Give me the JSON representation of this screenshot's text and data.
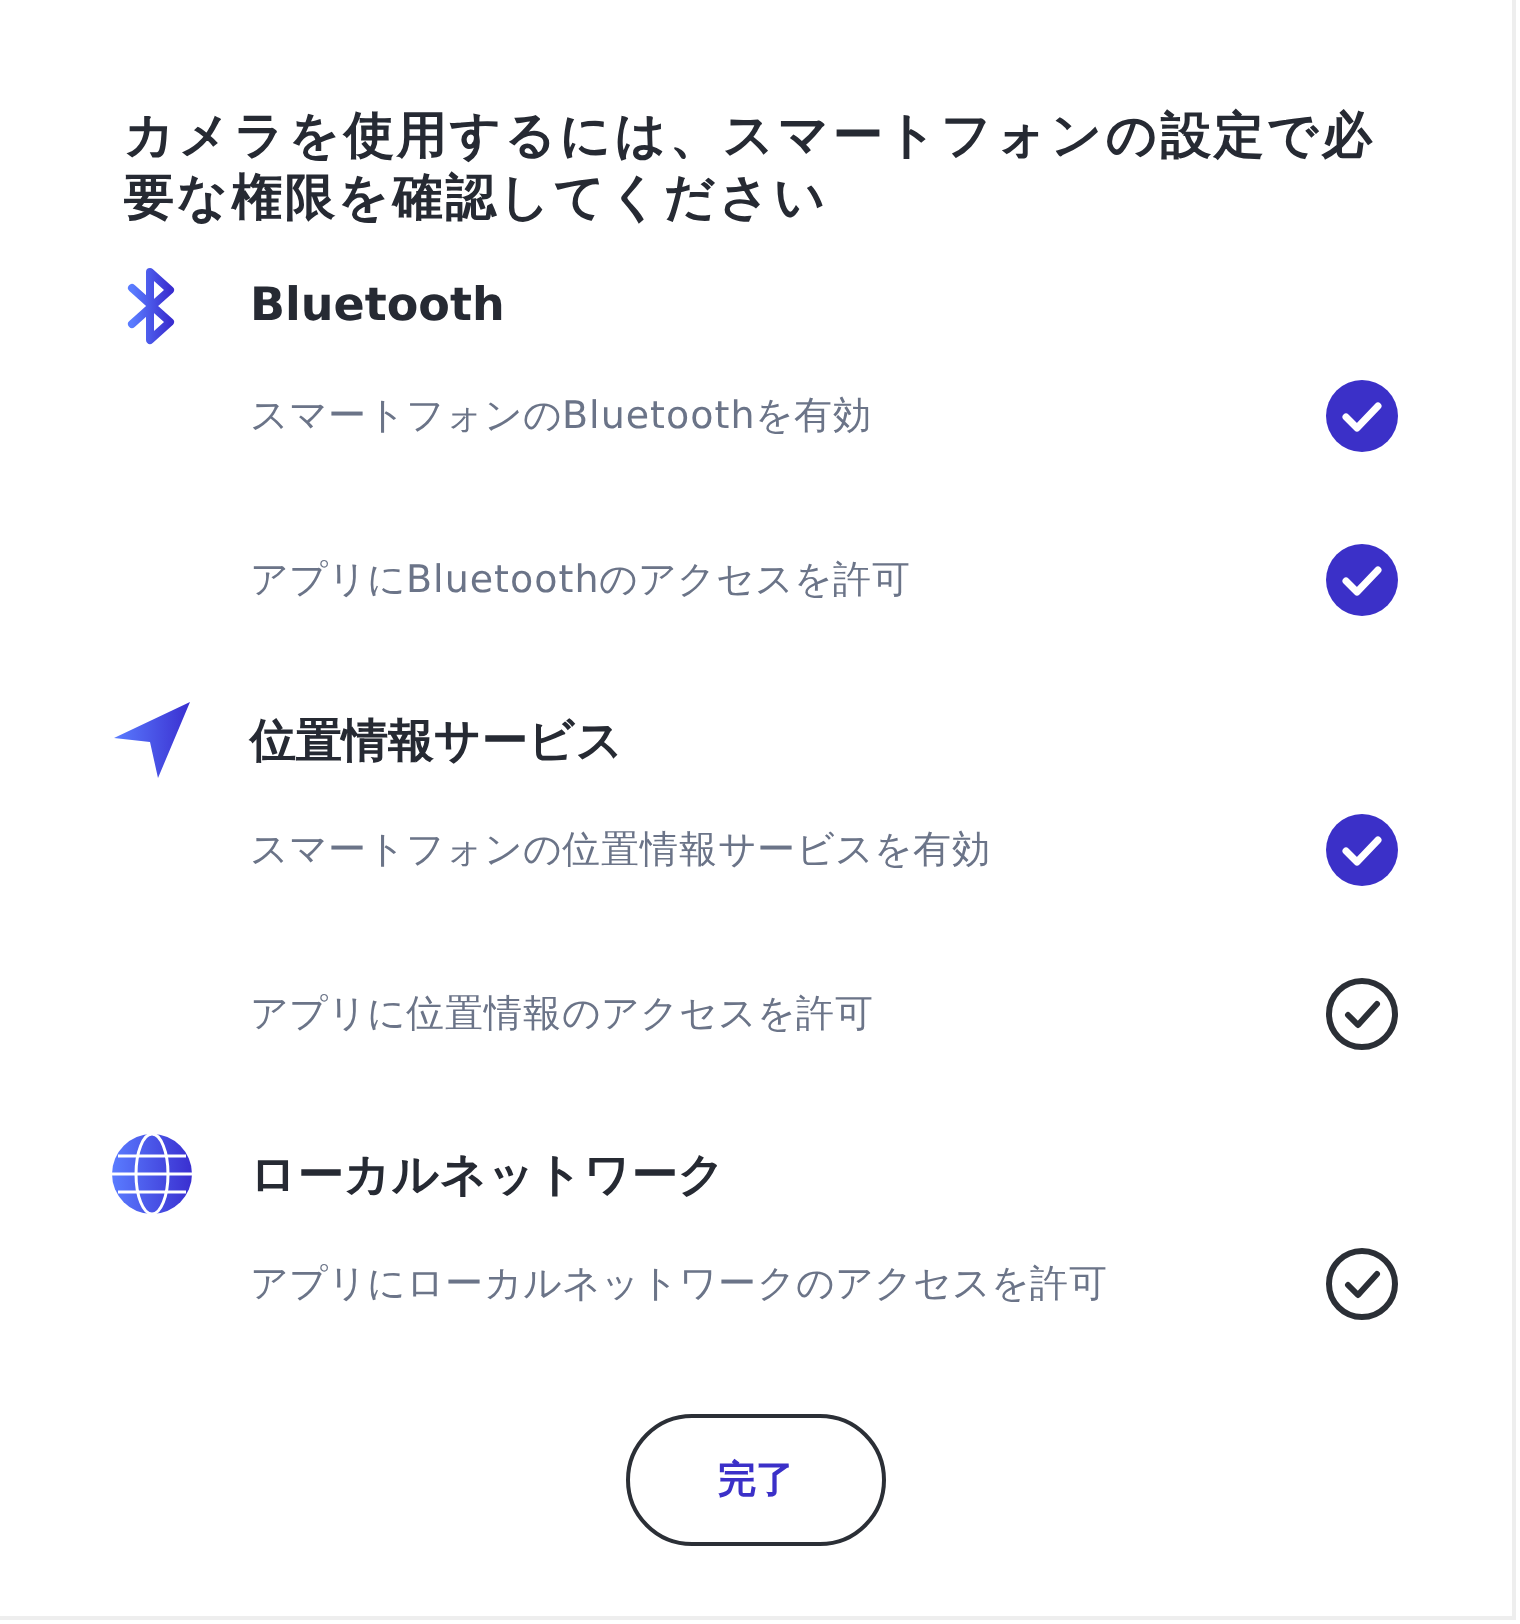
{
  "title": "カメラを使用するには、スマートフォンの設定で必要な権限を確認してください",
  "sections": [
    {
      "kind": "bluetooth",
      "heading": "Bluetooth",
      "items": [
        {
          "label": "スマートフォンのBluetoothを有効",
          "checked": true
        },
        {
          "label": "アプリにBluetoothのアクセスを許可",
          "checked": true
        }
      ]
    },
    {
      "kind": "location",
      "heading": "位置情報サービス",
      "items": [
        {
          "label": "スマートフォンの位置情報サービスを有効",
          "checked": true
        },
        {
          "label": "アプリに位置情報のアクセスを許可",
          "checked": false
        }
      ]
    },
    {
      "kind": "network",
      "heading": "ローカルネットワーク",
      "items": [
        {
          "label": "アプリにローカルネットワークのアクセスを許可",
          "checked": false
        }
      ]
    }
  ],
  "button": "完了"
}
